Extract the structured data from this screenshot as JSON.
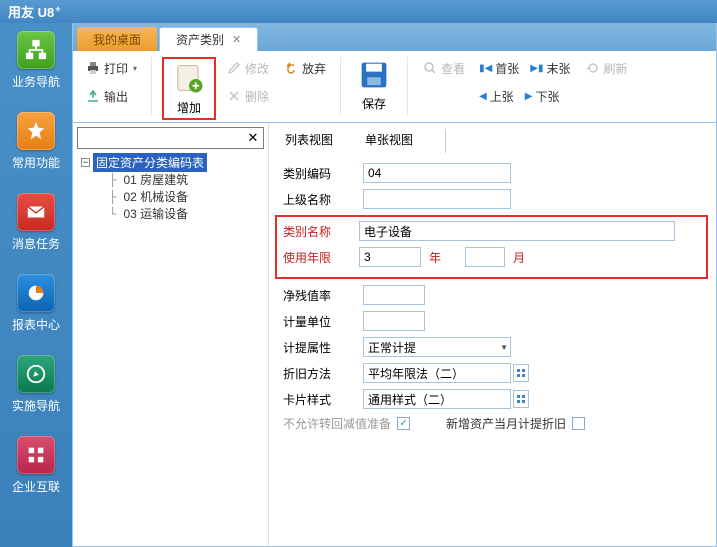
{
  "app_title": "用友 U8",
  "leftnav": [
    {
      "label": "业务导航"
    },
    {
      "label": "常用功能"
    },
    {
      "label": "消息任务"
    },
    {
      "label": "报表中心"
    },
    {
      "label": "实施导航"
    },
    {
      "label": "企业互联"
    }
  ],
  "tabs": {
    "home": "我的桌面",
    "active": "资产类别"
  },
  "toolbar": {
    "print": "打印",
    "output": "输出",
    "add": "增加",
    "edit": "修改",
    "delete": "删除",
    "abandon": "放弃",
    "save": "保存",
    "view": "查看",
    "first": "首张",
    "last": "末张",
    "prev": "上张",
    "next": "下张",
    "refresh": "刷新"
  },
  "tree": {
    "root": "固定资产分类编码表",
    "children": [
      "01  房屋建筑",
      "02  机械设备",
      "03  运输设备"
    ]
  },
  "viewtabs": {
    "list": "列表视图",
    "single": "单张视图"
  },
  "form": {
    "code_label": "类别编码",
    "code_value": "04",
    "parent_label": "上级名称",
    "name_label": "类别名称",
    "name_value": "电子设备",
    "life_label": "使用年限",
    "life_years": "3",
    "year_unit": "年",
    "month_unit": "月",
    "salvage_label": "净残值率",
    "unit_label": "计量单位",
    "attr_label": "计提属性",
    "attr_value": "正常计提",
    "method_label": "折旧方法",
    "method_value": "平均年限法（二）",
    "card_label": "卡片样式",
    "card_value": "通用样式（二）",
    "chk1": "不允许转回减值准备",
    "chk2": "新增资产当月计提折旧"
  }
}
